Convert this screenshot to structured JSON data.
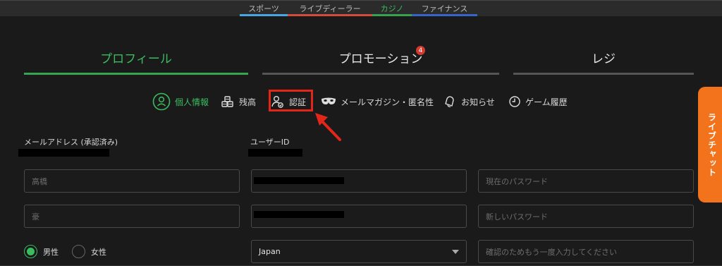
{
  "top_nav": [
    "スポーツ",
    "ライブディーラー",
    "カジノ",
    "ファイナンス"
  ],
  "main_tabs": {
    "profile": "プロフィール",
    "promotion": "プロモーション",
    "promotion_badge": "4",
    "register": "レジ"
  },
  "sub_tabs": {
    "personal_info": "個人情報",
    "balance": "残高",
    "verification": "認証",
    "mail_magazine": "メールマガジン・匿名性",
    "notices": "お知らせ",
    "game_history": "ゲーム履歴"
  },
  "labels": {
    "email": "メールアドレス (承認済み)",
    "user_id": "ユーザーID"
  },
  "fields": {
    "last_name_placeholder": "高橋",
    "first_name_placeholder": "豪",
    "country_value": "Japan",
    "current_password_placeholder": "現在のパスワード",
    "new_password_placeholder": "新しいパスワード",
    "confirm_password_placeholder": "確認のためもう一度入力してください"
  },
  "gender": {
    "male": "男性",
    "female": "女性",
    "selected": "male"
  },
  "live_chat": "ライブチャット",
  "colors": {
    "active_green": "#3bbd5f",
    "highlight_red": "#e3261a",
    "live_chat_orange": "#f2731c"
  }
}
